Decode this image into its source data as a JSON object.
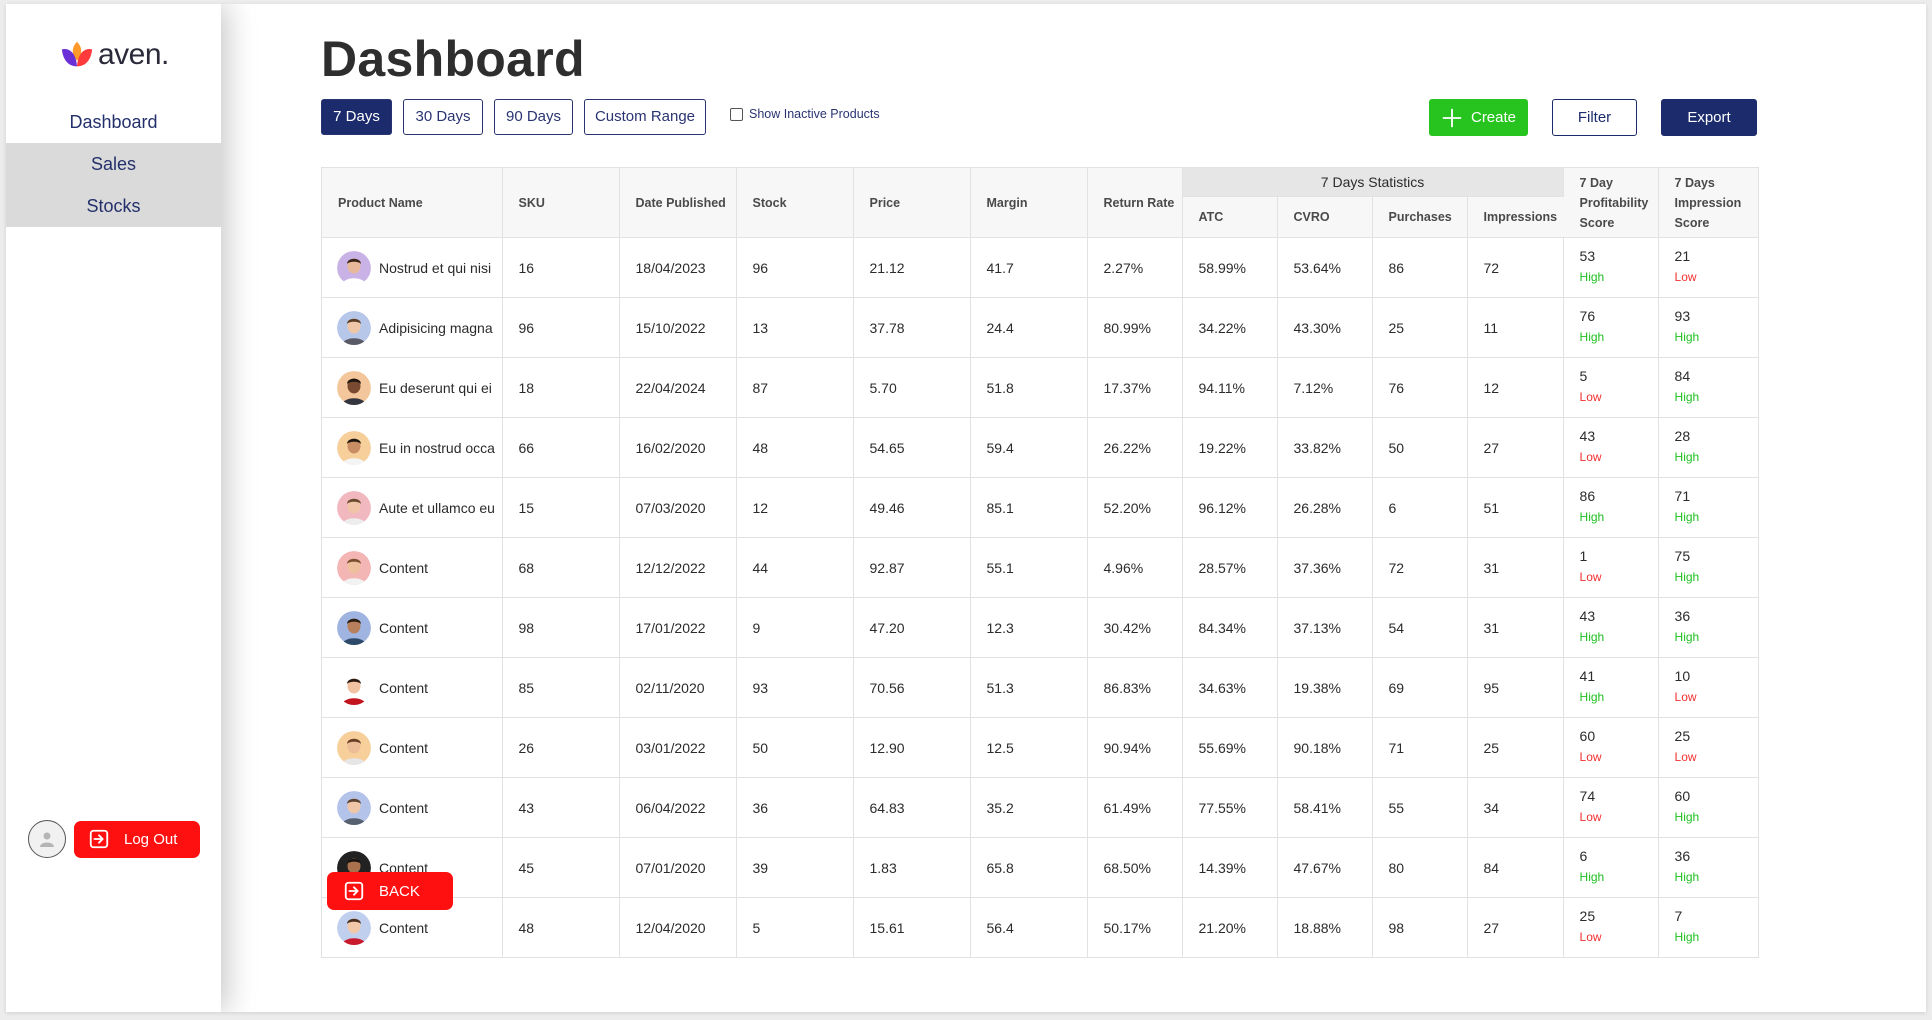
{
  "app": {
    "brand": "aven.",
    "brand_colors": {
      "petal_left": "#6a2fd6",
      "petal_right": "#ff3a3a",
      "petal_mid": "#ff9a2a"
    }
  },
  "sidebar": {
    "items": [
      {
        "label": "Dashboard"
      },
      {
        "label": "Sales"
      },
      {
        "label": "Stocks"
      }
    ],
    "logout_label": "Log Out",
    "user_icon": "user-icon"
  },
  "page": {
    "title": "Dashboard"
  },
  "ranges": [
    {
      "label": "7 Days",
      "active": true
    },
    {
      "label": "30 Days",
      "active": false
    },
    {
      "label": "90 Days",
      "active": false
    },
    {
      "label": "Custom Range",
      "active": false
    }
  ],
  "show_inactive": {
    "label": "Show Inactive Products",
    "checked": false
  },
  "actions": {
    "create": "Create",
    "filter": "Filter",
    "export": "Export"
  },
  "table": {
    "columns": {
      "product_name": "Product Name",
      "sku": "SKU",
      "date_published": "Date Published",
      "stock": "Stock",
      "price": "Price",
      "margin": "Margin",
      "return_rate": "Return Rate",
      "stats_group": "7 Days Statistics",
      "atc": "ATC",
      "cvro": "CVRO",
      "purchases": "Purchases",
      "impressions": "Impressions",
      "profit_score_l1": "7 Day",
      "profit_score_l2": "Profitability",
      "profit_score_l3": "Score",
      "impr_score_l1": "7 Days",
      "impr_score_l2": "Impression",
      "impr_score_l3": "Score"
    },
    "rows": [
      {
        "name": "Nostrud et qui nisi",
        "sku": "16",
        "date": "18/04/2023",
        "stock": "96",
        "price": "21.12",
        "margin": "41.7",
        "return_rate": "2.27%",
        "atc": "58.99%",
        "cvro": "53.64%",
        "purchases": "86",
        "impressions": "72",
        "profit_score": "53",
        "profit_level": "High",
        "impr_score": "21",
        "impr_level": "Low"
      },
      {
        "name": "Adipisicing magna",
        "sku": "96",
        "date": "15/10/2022",
        "stock": "13",
        "price": "37.78",
        "margin": "24.4",
        "return_rate": "80.99%",
        "atc": "34.22%",
        "cvro": "43.30%",
        "purchases": "25",
        "impressions": "11",
        "profit_score": "76",
        "profit_level": "High",
        "impr_score": "93",
        "impr_level": "High"
      },
      {
        "name": "Eu deserunt qui ei",
        "sku": "18",
        "date": "22/04/2024",
        "stock": "87",
        "price": "5.70",
        "margin": "51.8",
        "return_rate": "17.37%",
        "atc": "94.11%",
        "cvro": "7.12%",
        "purchases": "76",
        "impressions": "12",
        "profit_score": "5",
        "profit_level": "Low",
        "impr_score": "84",
        "impr_level": "High"
      },
      {
        "name": "Eu in nostrud occa",
        "sku": "66",
        "date": "16/02/2020",
        "stock": "48",
        "price": "54.65",
        "margin": "59.4",
        "return_rate": "26.22%",
        "atc": "19.22%",
        "cvro": "33.82%",
        "purchases": "50",
        "impressions": "27",
        "profit_score": "43",
        "profit_level": "Low",
        "impr_score": "28",
        "impr_level": "High"
      },
      {
        "name": "Aute et ullamco eu",
        "sku": "15",
        "date": "07/03/2020",
        "stock": "12",
        "price": "49.46",
        "margin": "85.1",
        "return_rate": "52.20%",
        "atc": "96.12%",
        "cvro": "26.28%",
        "purchases": "6",
        "impressions": "51",
        "profit_score": "86",
        "profit_level": "High",
        "impr_score": "71",
        "impr_level": "High"
      },
      {
        "name": "Content",
        "sku": "68",
        "date": "12/12/2022",
        "stock": "44",
        "price": "92.87",
        "margin": "55.1",
        "return_rate": "4.96%",
        "atc": "28.57%",
        "cvro": "37.36%",
        "purchases": "72",
        "impressions": "31",
        "profit_score": "1",
        "profit_level": "Low",
        "impr_score": "75",
        "impr_level": "High"
      },
      {
        "name": "Content",
        "sku": "98",
        "date": "17/01/2022",
        "stock": "9",
        "price": "47.20",
        "margin": "12.3",
        "return_rate": "30.42%",
        "atc": "84.34%",
        "cvro": "37.13%",
        "purchases": "54",
        "impressions": "31",
        "profit_score": "43",
        "profit_level": "High",
        "impr_score": "36",
        "impr_level": "High"
      },
      {
        "name": "Content",
        "sku": "85",
        "date": "02/11/2020",
        "stock": "93",
        "price": "70.56",
        "margin": "51.3",
        "return_rate": "86.83%",
        "atc": "34.63%",
        "cvro": "19.38%",
        "purchases": "69",
        "impressions": "95",
        "profit_score": "41",
        "profit_level": "High",
        "impr_score": "10",
        "impr_level": "Low"
      },
      {
        "name": "Content",
        "sku": "26",
        "date": "03/01/2022",
        "stock": "50",
        "price": "12.90",
        "margin": "12.5",
        "return_rate": "90.94%",
        "atc": "55.69%",
        "cvro": "90.18%",
        "purchases": "71",
        "impressions": "25",
        "profit_score": "60",
        "profit_level": "Low",
        "impr_score": "25",
        "impr_level": "Low"
      },
      {
        "name": "Content",
        "sku": "43",
        "date": "06/04/2022",
        "stock": "36",
        "price": "64.83",
        "margin": "35.2",
        "return_rate": "61.49%",
        "atc": "77.55%",
        "cvro": "58.41%",
        "purchases": "55",
        "impressions": "34",
        "profit_score": "74",
        "profit_level": "Low",
        "impr_score": "60",
        "impr_level": "High"
      },
      {
        "name": "Content",
        "sku": "45",
        "date": "07/01/2020",
        "stock": "39",
        "price": "1.83",
        "margin": "65.8",
        "return_rate": "68.50%",
        "atc": "14.39%",
        "cvro": "47.67%",
        "purchases": "80",
        "impressions": "84",
        "profit_score": "6",
        "profit_level": "High",
        "impr_score": "36",
        "impr_level": "High"
      },
      {
        "name": "Content",
        "sku": "48",
        "date": "12/04/2020",
        "stock": "5",
        "price": "15.61",
        "margin": "56.4",
        "return_rate": "50.17%",
        "atc": "21.20%",
        "cvro": "18.88%",
        "purchases": "98",
        "impressions": "27",
        "profit_score": "25",
        "profit_level": "Low",
        "impr_score": "7",
        "impr_level": "High"
      }
    ],
    "avatars": [
      {
        "bg": "#c9b3e6",
        "skin": "#e7b99a",
        "hair": "#3a2418",
        "shirt": "#ffffff"
      },
      {
        "bg": "#b6c7ea",
        "skin": "#f0c6a8",
        "hair": "#5a3d26",
        "shirt": "#5a5a66"
      },
      {
        "bg": "#f3c79b",
        "skin": "#7a4a30",
        "hair": "#1d1410",
        "shirt": "#33363f"
      },
      {
        "bg": "#f6cf9b",
        "skin": "#c98d64",
        "hair": "#1f1812",
        "shirt": "#f4f4f4"
      },
      {
        "bg": "#f2b8c0",
        "skin": "#f0c4a6",
        "hair": "#6a4a2e",
        "shirt": "#ededed"
      },
      {
        "bg": "#f4b5b5",
        "skin": "#efc09d",
        "hair": "#7a5030",
        "shirt": "#f2f2f2"
      },
      {
        "bg": "#9fb4e0",
        "skin": "#b77f5b",
        "hair": "#2a1d14",
        "shirt": "#2d4a6a"
      },
      {
        "bg": "#ffffff",
        "skin": "#f0c2a2",
        "hair": "#2a1a12",
        "shirt": "#c2141e"
      },
      {
        "bg": "#f6cf9b",
        "skin": "#edbd98",
        "hair": "#6a4126",
        "shirt": "#e6e6e6"
      },
      {
        "bg": "#b3c3ea",
        "skin": "#f0c6a8",
        "hair": "#5c4330",
        "shirt": "#57606e"
      },
      {
        "bg": "#222222",
        "skin": "#a9714e",
        "hair": "#1a1410",
        "shirt": "#1f2d44"
      },
      {
        "bg": "#c0cfee",
        "skin": "#f1c7a9",
        "hair": "#4a2f1f",
        "shirt": "#c81a2c"
      }
    ]
  },
  "back_label": "BACK",
  "colors": {
    "navy": "#1c2b6b",
    "green": "#27c41f",
    "red": "#ff1010",
    "high": "#20c020",
    "low": "#f23030"
  }
}
